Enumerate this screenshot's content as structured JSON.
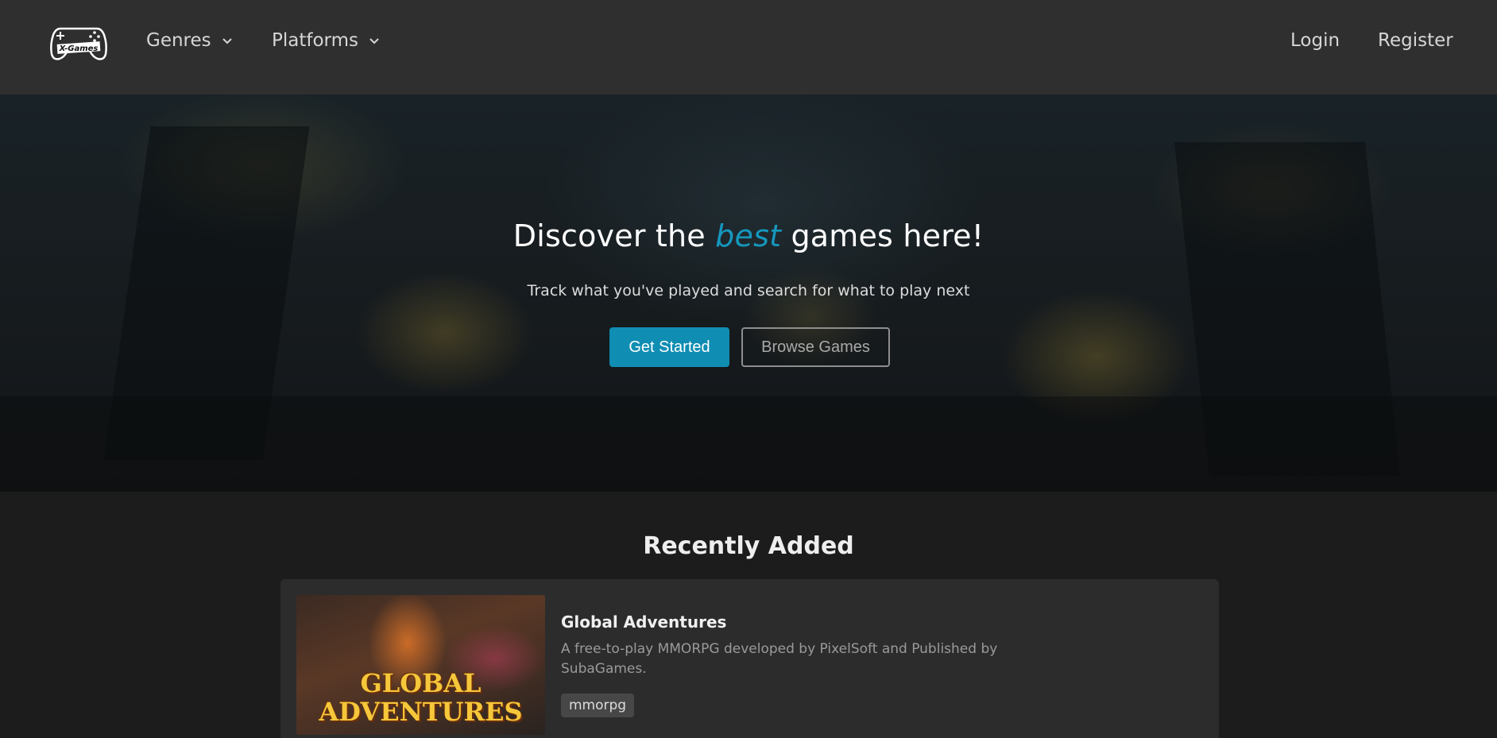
{
  "navbar": {
    "logo_text": "X-Games",
    "genres_label": "Genres",
    "platforms_label": "Platforms",
    "login_label": "Login",
    "register_label": "Register"
  },
  "hero": {
    "title_before": "Discover the ",
    "title_accent": "best",
    "title_after": " games here!",
    "subtitle": "Track what you've played and search for what to play next",
    "primary_button": "Get Started",
    "secondary_button": "Browse Games"
  },
  "recently_added": {
    "heading": "Recently Added",
    "items": [
      {
        "thumb_line1": "GLOBAL",
        "thumb_line2": "ADVENTURES",
        "title": "Global Adventures",
        "description": "A free-to-play MMORPG developed by PixelSoft and Published by SubaGames.",
        "tag": "mmorpg"
      }
    ]
  },
  "colors": {
    "navbar_bg": "#2f2f2f",
    "page_bg": "#1c1c1c",
    "accent": "#1597bd",
    "primary_button": "#0f8db3"
  }
}
